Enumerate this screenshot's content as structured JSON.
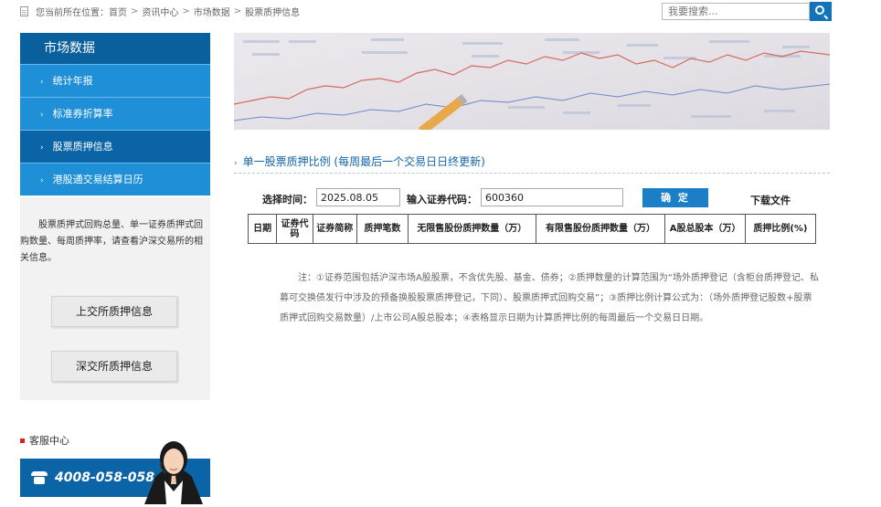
{
  "breadcrumb": {
    "prefix": "您当前所在位置：",
    "items": [
      "首页",
      "资讯中心",
      "市场数据",
      "股票质押信息"
    ],
    "separator": ">"
  },
  "search": {
    "placeholder": "我要搜索..."
  },
  "sidebar": {
    "title": "市场数据",
    "items": [
      {
        "label": "统计年报"
      },
      {
        "label": "标准券折算率"
      },
      {
        "label": "股票质押信息"
      },
      {
        "label": "港股通交易结算日历"
      }
    ],
    "description": "股票质押式回购总量、单一证券质押式回购数量、每周质押率，请查看沪深交易所的相关信息。",
    "buttons": {
      "sh": "上交所质押信息",
      "sz": "深交所质押信息"
    }
  },
  "service": {
    "title": "客服中心",
    "phone": "4008-058-058"
  },
  "main": {
    "section_title": "单一股票质押比例 (每周最后一个交易日日终更新)",
    "query": {
      "date_label": "选择时间：",
      "date_value": "2025.08.05",
      "code_label": "输入证券代码：",
      "code_value": "600360",
      "confirm_label": "确 定",
      "download_label": "下载文件"
    },
    "table_headers": [
      "日期",
      "证券代码",
      "证券简称",
      "质押笔数",
      "无限售股份质押数量（万）",
      "有限售股份质押数量（万）",
      "A股总股本（万）",
      "质押比例(%)"
    ],
    "notes": "注：①证券范围包括沪深市场A股股票，不含优先股、基金、债券；②质押数量的计算范围为“场外质押登记（含柜台质押登记、私募可交换债发行中涉及的预备换股股票质押登记，下同）、股票质押式回购交易”；③质押比例计算公式为：（场外质押登记股数+股票质押式回购交易数量）/上市公司A股总股本；④表格显示日期为计算质押比例的每周最后一个交易日日期。"
  },
  "colors": {
    "sidebar_title_bg": "#0a5f9d",
    "sidebar_item_bg": "#1f8fd7",
    "sidebar_active_bg": "#0b64a6",
    "accent": "#1a7fc6",
    "title_text": "#1565a9"
  },
  "icons": {
    "breadcrumb": "document-icon",
    "search": "search-icon",
    "service_marker": "red-square-icon",
    "phone": "telephone-icon"
  }
}
